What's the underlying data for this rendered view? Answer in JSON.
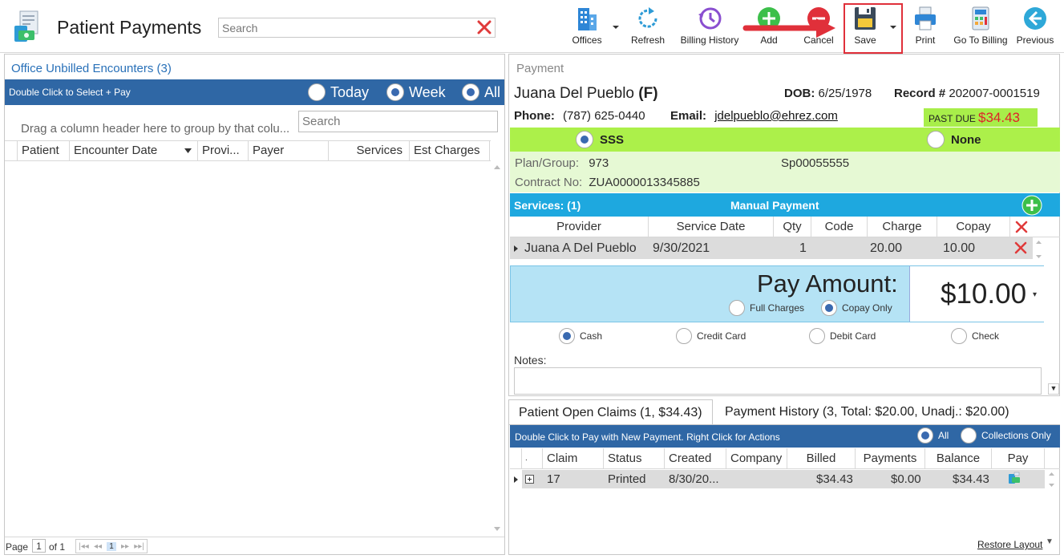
{
  "header": {
    "title": "Patient Payments",
    "search_placeholder": "Search",
    "toolbar": [
      {
        "label": "Offices"
      },
      {
        "label": "Refresh"
      },
      {
        "label": "Billing History"
      },
      {
        "label": "Add"
      },
      {
        "label": "Cancel"
      },
      {
        "label": "Save"
      },
      {
        "label": "Print"
      },
      {
        "label": "Go To Billing"
      },
      {
        "label": "Previous"
      }
    ],
    "colors": {
      "accent": "#2f67a5",
      "highlight": "#e0303a"
    }
  },
  "left": {
    "title": "Office Unbilled Encounters (3)",
    "bar_text": "Double Click to Select + Pay",
    "filters": [
      {
        "label": "Today",
        "selected": false
      },
      {
        "label": "Week",
        "selected": true
      },
      {
        "label": "All",
        "selected": true
      }
    ],
    "group_hint": "Drag a column header here to group by that colu...",
    "search_placeholder": "Search",
    "columns": [
      "Patient",
      "Encounter Date",
      "Provi...",
      "Payer",
      "Services",
      "Est Charges"
    ],
    "pager": {
      "page_label": "Page",
      "page": "1",
      "of": "of 1",
      "current": "1"
    }
  },
  "payment": {
    "section_label": "Payment",
    "patient_name": "Juana Del Pueblo",
    "sex": "(F)",
    "dob_label": "DOB:",
    "dob": "6/25/1978",
    "record_label": "Record #",
    "record": "202007-0001519",
    "phone_label": "Phone:",
    "phone": "(787) 625-0440",
    "email_label": "Email:",
    "email": "jdelpueblo@ehrez.com",
    "past_due_label": "PAST DUE",
    "past_due_amount": "$34.43",
    "plans": [
      {
        "label": "SSS",
        "selected": true
      },
      {
        "label": "None",
        "selected": false
      }
    ],
    "plan_group_label": "Plan/Group:",
    "plan_group": "973",
    "plan_group_2": "Sp00055555",
    "contract_label": "Contract No:",
    "contract": "ZUA0000013345885",
    "services_title": "Services: (1)",
    "manual_payment": "Manual Payment",
    "service_columns": [
      "Provider",
      "Service Date",
      "Qty",
      "Code",
      "Charge",
      "Copay"
    ],
    "service_rows": [
      {
        "provider": "Juana A Del Pueblo",
        "date": "9/30/2021",
        "qty": "1",
        "code": "",
        "charge": "20.00",
        "copay": "10.00"
      }
    ],
    "pay_amount_label": "Pay Amount:",
    "pay_amount": "$10.00",
    "pay_options": [
      {
        "label": "Full Charges",
        "selected": false
      },
      {
        "label": "Copay Only",
        "selected": true
      }
    ],
    "methods": [
      {
        "label": "Cash",
        "selected": true
      },
      {
        "label": "Credit Card",
        "selected": false
      },
      {
        "label": "Debit Card",
        "selected": false
      },
      {
        "label": "Check",
        "selected": false
      }
    ],
    "notes_label": "Notes:"
  },
  "bottom": {
    "tabs": [
      {
        "label": "Patient Open Claims (1, $34.43)",
        "active": true
      },
      {
        "label": "Payment History (3, Total: $20.00, Unadj.: $20.00)",
        "active": false
      }
    ],
    "bar_text": "Double Click to Pay with New Payment. Right Click for Actions",
    "filters": [
      {
        "label": "All",
        "selected": true
      },
      {
        "label": "Collections Only",
        "selected": false
      }
    ],
    "columns": [
      "Claim",
      "Status",
      "Created",
      "Company",
      "Billed",
      "Payments",
      "Balance",
      "Pay"
    ],
    "rows": [
      {
        "claim": "17",
        "status": "Printed",
        "created": "8/30/20...",
        "company": "",
        "billed": "$34.43",
        "payments": "$0.00",
        "balance": "$34.43"
      }
    ],
    "restore_layout": "Restore Layout"
  }
}
